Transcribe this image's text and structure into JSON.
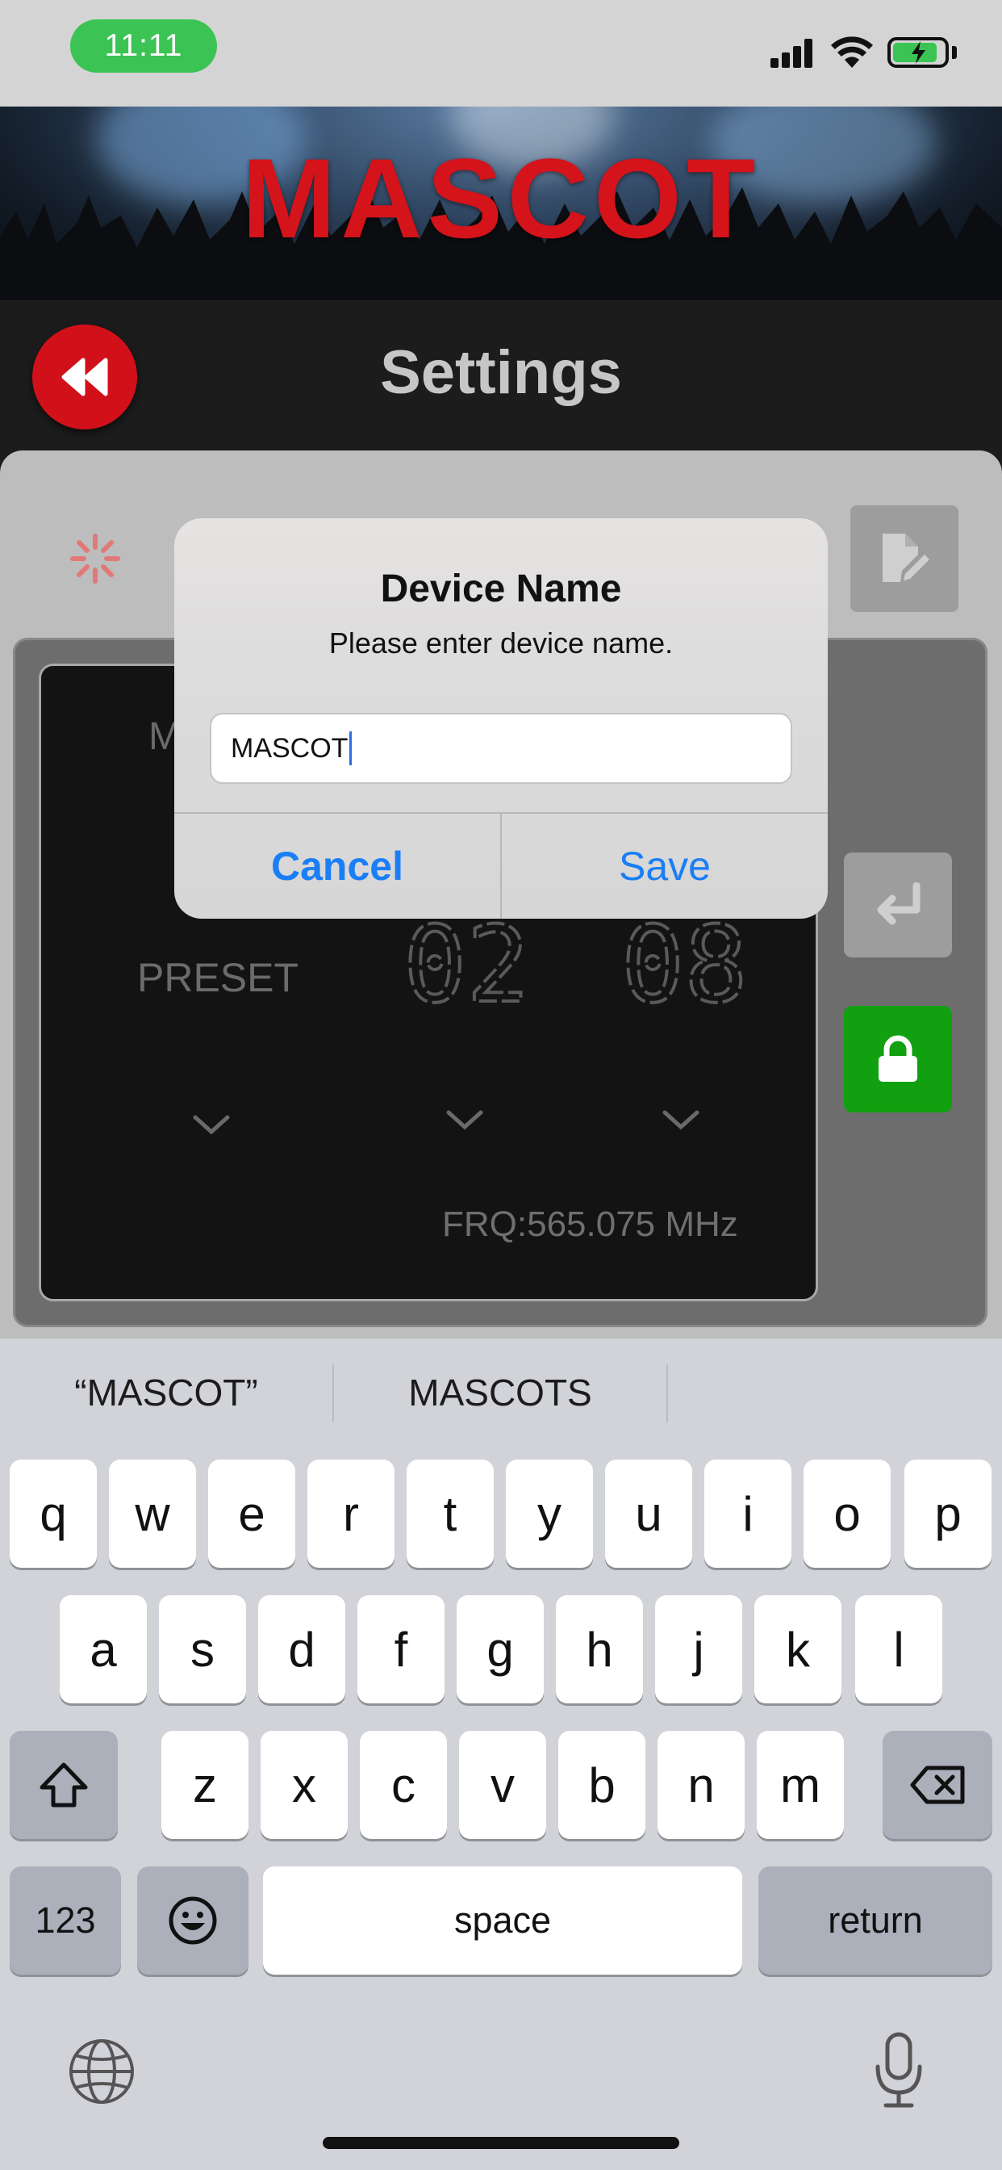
{
  "status_bar": {
    "time": "11:11"
  },
  "banner": {
    "title": "MASCOT"
  },
  "header": {
    "title": "Settings"
  },
  "panel": {
    "label_initial": "M",
    "preset_label": "PRESET",
    "group_value": "02",
    "channel_value": "08",
    "frequency": "FRQ:565.075 MHz"
  },
  "dialog": {
    "title": "Device Name",
    "message": "Please enter device name.",
    "input_value": "MASCOT",
    "cancel_label": "Cancel",
    "save_label": "Save"
  },
  "keyboard": {
    "suggestions": [
      "“MASCOT”",
      "MASCOTS"
    ],
    "row1": [
      "q",
      "w",
      "e",
      "r",
      "t",
      "y",
      "u",
      "i",
      "o",
      "p"
    ],
    "row2": [
      "a",
      "s",
      "d",
      "f",
      "g",
      "h",
      "j",
      "k",
      "l"
    ],
    "row3": [
      "z",
      "x",
      "c",
      "v",
      "b",
      "n",
      "m"
    ],
    "numbers_label": "123",
    "space_label": "space",
    "return_label": "return"
  },
  "colors": {
    "brand_red": "#d1101a",
    "lock_green": "#10a010",
    "ios_blue": "#1a7ef6",
    "status_green": "#3bc453"
  },
  "icons": [
    "rewind-icon",
    "spinner-icon",
    "edit-document-icon",
    "return-arrow-icon",
    "lock-icon",
    "chevron-down-icon",
    "shift-icon",
    "backspace-icon",
    "emoji-icon",
    "globe-icon",
    "microphone-icon",
    "wifi-icon",
    "battery-icon",
    "signal-icon"
  ]
}
